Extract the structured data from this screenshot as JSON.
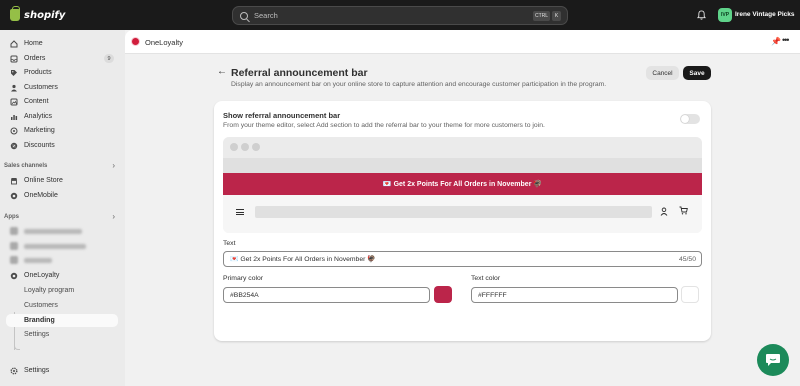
{
  "topbar": {
    "logo": "shopify",
    "search_placeholder": "Search",
    "shortcut_ctrl": "CTRL",
    "shortcut_k": "K",
    "store_initials": "IVP",
    "store_name": "Irene Vintage Picks"
  },
  "sidebar": {
    "items": [
      {
        "label": "Home",
        "icon": "home-icon"
      },
      {
        "label": "Orders",
        "icon": "orders-icon",
        "badge": "9"
      },
      {
        "label": "Products",
        "icon": "products-icon"
      },
      {
        "label": "Customers",
        "icon": "customers-icon"
      },
      {
        "label": "Content",
        "icon": "content-icon"
      },
      {
        "label": "Analytics",
        "icon": "analytics-icon"
      },
      {
        "label": "Marketing",
        "icon": "marketing-icon"
      },
      {
        "label": "Discounts",
        "icon": "discounts-icon"
      }
    ],
    "sales_channels_label": "Sales channels",
    "channels": [
      {
        "label": "Online Store",
        "icon": "online-store-icon"
      },
      {
        "label": "OneMobile",
        "icon": "app-icon"
      }
    ],
    "apps_label": "Apps",
    "app_name": "OneLoyalty",
    "app_subitems": [
      "Loyalty program",
      "Customers",
      "Branding",
      "Settings"
    ],
    "settings_label": "Settings"
  },
  "app_header": {
    "name": "OneLoyalty"
  },
  "page": {
    "title": "Referral announcement bar",
    "description": "Display an announcement bar on your online store to capture attention and encourage customer participation in the program.",
    "cancel_label": "Cancel",
    "save_label": "Save"
  },
  "card": {
    "title": "Show referral announcement bar",
    "description": "From your theme editor, select Add section to add the referral bar to your theme for more customers to join.",
    "toggle_on": false,
    "preview_text": "💌 Get 2x Points For All Orders in November 🦃"
  },
  "form": {
    "text_label": "Text",
    "text_value": "💌 Get 2x Points For All Orders in November 🦃",
    "text_counter": "45/50",
    "primary_color_label": "Primary color",
    "primary_color_value": "#BB254A",
    "text_color_label": "Text color",
    "text_color_value": "#FFFFFF"
  },
  "colors": {
    "primary": "#bb254a",
    "text": "#ffffff",
    "brand_green": "#95bf47"
  }
}
